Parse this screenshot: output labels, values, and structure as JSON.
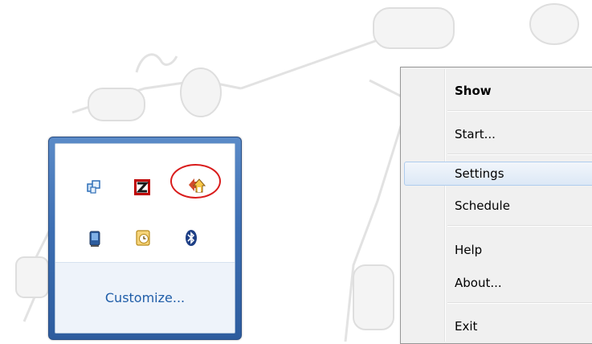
{
  "tray_flyout": {
    "icons": [
      {
        "name": "network-windows-icon"
      },
      {
        "name": "filezilla-icon"
      },
      {
        "name": "backup-app-icon",
        "highlighted": true
      },
      {
        "name": "device-icon"
      },
      {
        "name": "clock-calendar-icon"
      },
      {
        "name": "bluetooth-icon"
      }
    ],
    "customize_label": "Customize..."
  },
  "context_menu": {
    "items": [
      {
        "label": "Show",
        "bold": true
      },
      {
        "label": "Start..."
      },
      {
        "label": "Settings",
        "hover": true
      },
      {
        "label": "Schedule"
      },
      {
        "label": "Help"
      },
      {
        "label": "About..."
      },
      {
        "label": "Exit"
      }
    ]
  },
  "colors": {
    "flyout_frame": "#3d6fb3",
    "link": "#1f5da8",
    "highlight_ring": "#d91c1c",
    "menu_bg": "#f0f0f0",
    "menu_hover": "#dce8f6"
  }
}
